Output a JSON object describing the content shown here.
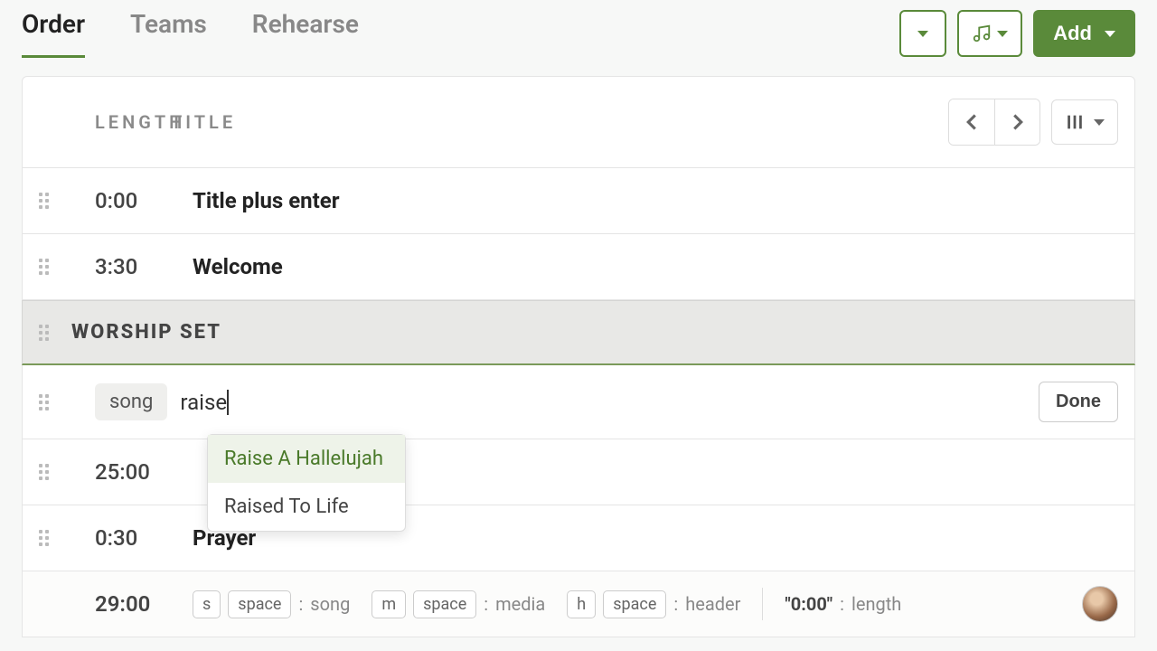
{
  "tabs": [
    {
      "label": "Order",
      "active": true
    },
    {
      "label": "Teams",
      "active": false
    },
    {
      "label": "Rehearse",
      "active": false
    }
  ],
  "add_button": {
    "label": "Add"
  },
  "columns": {
    "length": "LENGTH",
    "title": "TITLE"
  },
  "rows": [
    {
      "length": "0:00",
      "title": "Title plus enter"
    },
    {
      "length": "3:30",
      "title": "Welcome"
    }
  ],
  "section": {
    "title": "WORSHIP SET"
  },
  "song_input": {
    "chip": "song",
    "value": "raise",
    "done_label": "Done",
    "autocomplete": [
      "Raise A Hallelujah",
      "Raised To Life"
    ]
  },
  "rows_after": [
    {
      "length": "25:00",
      "title": ""
    },
    {
      "length": "0:30",
      "title": "Prayer"
    }
  ],
  "footer": {
    "total": "29:00",
    "hints": [
      {
        "keys": [
          "s",
          "space"
        ],
        "label": "song"
      },
      {
        "keys": [
          "m",
          "space"
        ],
        "label": "media"
      },
      {
        "keys": [
          "h",
          "space"
        ],
        "label": "header"
      }
    ],
    "length_hint": {
      "quote": "\"0:00\"",
      "label": "length"
    }
  }
}
